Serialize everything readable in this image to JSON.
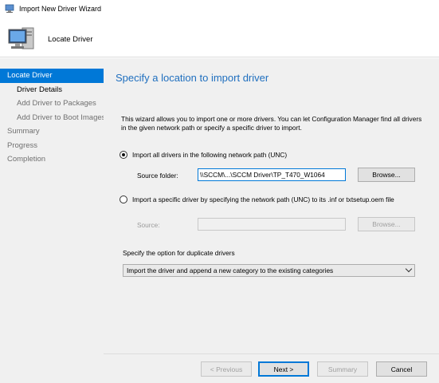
{
  "window": {
    "title": "Import New Driver Wizard"
  },
  "header": {
    "page_name": "Locate Driver"
  },
  "sidebar": {
    "items": [
      {
        "label": "Locate Driver",
        "active": true
      },
      {
        "label": "Driver Details"
      },
      {
        "label": "Add Driver to Packages"
      },
      {
        "label": "Add Driver to Boot Images"
      },
      {
        "label": "Summary"
      },
      {
        "label": "Progress"
      },
      {
        "label": "Completion"
      }
    ]
  },
  "main": {
    "heading": "Specify a location to import driver",
    "description": "This wizard allows you to import one or more drivers. You can let Configuration Manager find all drivers in the given network path or specify a specific driver to import.",
    "option_unc": {
      "label": "Import all drivers in the following network path (UNC)",
      "checked": true
    },
    "source_folder": {
      "label": "Source folder:",
      "value": "\\\\SCCM\\...\\SCCM Driver\\TP_T470_W1064",
      "browse_label": "Browse..."
    },
    "option_specific": {
      "label": "Import a specific driver by specifying the network path (UNC) to its .inf or txtsetup.oem file",
      "checked": false
    },
    "source": {
      "label": "Source:",
      "value": "",
      "browse_label": "Browse..."
    },
    "duplicate": {
      "label": "Specify the option for duplicate drivers",
      "selected": "Import the driver and append a new category to the existing categories"
    }
  },
  "footer": {
    "previous_label": "< Previous",
    "next_label": "Next >",
    "summary_label": "Summary",
    "cancel_label": "Cancel"
  },
  "colors": {
    "accent": "#0078d7",
    "heading": "#1f6fbf",
    "panel": "#f0f0f0"
  }
}
